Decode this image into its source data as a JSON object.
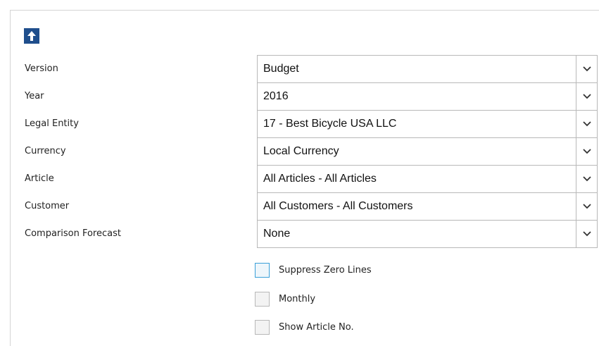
{
  "toolbar": {
    "up_icon": "arrow-up-icon"
  },
  "colors": {
    "accent": "#1f4e8c",
    "focus_border": "#3aa0d8",
    "border": "#b8b8b8"
  },
  "fields": {
    "version": {
      "label": "Version",
      "value": "Budget"
    },
    "year": {
      "label": "Year",
      "value": "2016"
    },
    "legal_entity": {
      "label": "Legal Entity",
      "value": "17 - Best Bicycle USA LLC"
    },
    "currency": {
      "label": "Currency",
      "value": "Local Currency"
    },
    "article": {
      "label": "Article",
      "value": "All Articles - All Articles"
    },
    "customer": {
      "label": "Customer",
      "value": "All Customers - All Customers"
    },
    "comparison_forecast": {
      "label": "Comparison Forecast",
      "value": "None"
    }
  },
  "checkboxes": {
    "suppress_zero_lines": {
      "label": "Suppress Zero Lines",
      "checked": false
    },
    "monthly": {
      "label": "Monthly",
      "checked": false
    },
    "show_article_no": {
      "label": "Show Article No.",
      "checked": false
    }
  }
}
